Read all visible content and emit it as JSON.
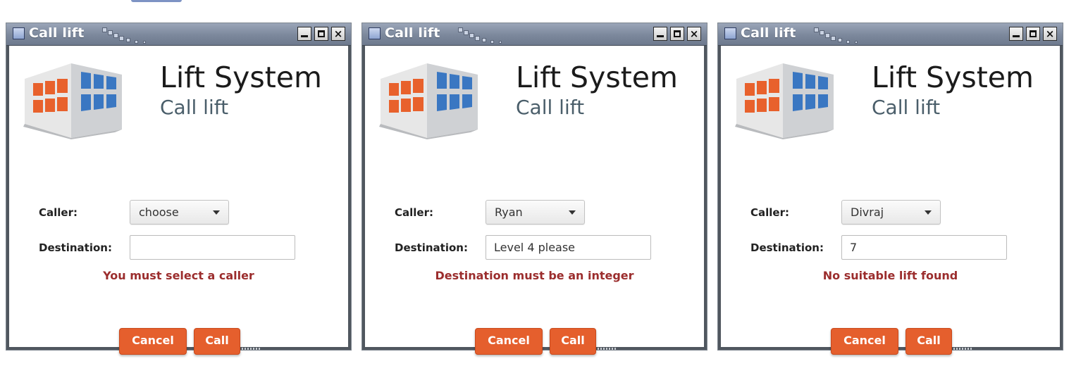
{
  "windows": [
    {
      "title": "Call lift",
      "app_title": "Lift System",
      "app_subtitle": "Call lift",
      "caller_label": "Caller:",
      "caller_value": "choose",
      "destination_label": "Destination:",
      "destination_value": "",
      "error_message": "You must select a caller",
      "cancel_label": "Cancel",
      "call_label": "Call"
    },
    {
      "title": "Call lift",
      "app_title": "Lift System",
      "app_subtitle": "Call lift",
      "caller_label": "Caller:",
      "caller_value": "Ryan",
      "destination_label": "Destination:",
      "destination_value": "Level 4 please",
      "error_message": "Destination must be an integer",
      "cancel_label": "Cancel",
      "call_label": "Call"
    },
    {
      "title": "Call lift",
      "app_title": "Lift System",
      "app_subtitle": "Call lift",
      "caller_label": "Caller:",
      "caller_value": "Divraj",
      "destination_label": "Destination:",
      "destination_value": "7",
      "error_message": "No suitable lift found",
      "cancel_label": "Cancel",
      "call_label": "Call"
    }
  ],
  "icons": {
    "window": "window-icon",
    "minimize": "minimize-icon",
    "maximize": "maximize-icon",
    "close": "close-icon",
    "logo": "building-logo",
    "dropdown": "chevron-down-icon"
  },
  "colors": {
    "accent": "#e55f2d",
    "error": "#9b2d2d",
    "subtitle": "#4a5e6a",
    "logo_orange": "#e8612c",
    "logo_blue": "#3a77c2"
  }
}
